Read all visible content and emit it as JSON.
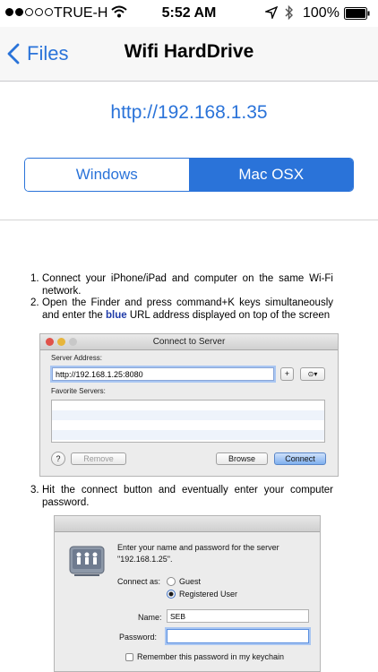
{
  "status_bar": {
    "carrier": "TRUE-H",
    "time": "5:52 AM",
    "battery": "100%",
    "icons": [
      "signal-dots",
      "wifi-icon",
      "location-icon",
      "bluetooth-icon",
      "battery-icon"
    ]
  },
  "nav": {
    "back_label": "Files",
    "title": "Wifi HardDrive"
  },
  "server_url": "http://192.168.1.35",
  "segments": {
    "windows": "Windows",
    "mac": "Mac OSX",
    "selected": "Mac OSX"
  },
  "colors": {
    "accent": "#2a73d9",
    "highlight": "#1f3ba8"
  },
  "instructions": {
    "step1_num": "1.",
    "step1": "Connect your iPhone/iPad and computer on the same Wi-Fi network.",
    "step2_num": "2.",
    "step2_a": "Open the Finder and press command+K keys simultaneously and enter the ",
    "step2_blue": "blue",
    "step2_b": " URL address displayed on top of the screen",
    "step3_num": "3.",
    "step3": "Hit the connect button and eventually enter your computer password."
  },
  "connect_dialog": {
    "title": "Connect to Server",
    "server_address_label": "Server Address:",
    "server_address_value": "http://192.168.1.25:8080",
    "plus_label": "+",
    "history_label": "⊙▾",
    "favorites_label": "Favorite Servers:",
    "help_label": "?",
    "remove_label": "Remove",
    "browse_label": "Browse",
    "connect_label": "Connect"
  },
  "auth_dialog": {
    "prompt_line1": "Enter your name and password for the server",
    "prompt_line2": "\"192.168.1.25\".",
    "connect_as_label": "Connect as:",
    "guest_label": "Guest",
    "registered_label": "Registered User",
    "name_label": "Name:",
    "name_value": "SEB",
    "password_label": "Password:",
    "password_value": "",
    "keychain_label": "Remember this password in my keychain"
  }
}
